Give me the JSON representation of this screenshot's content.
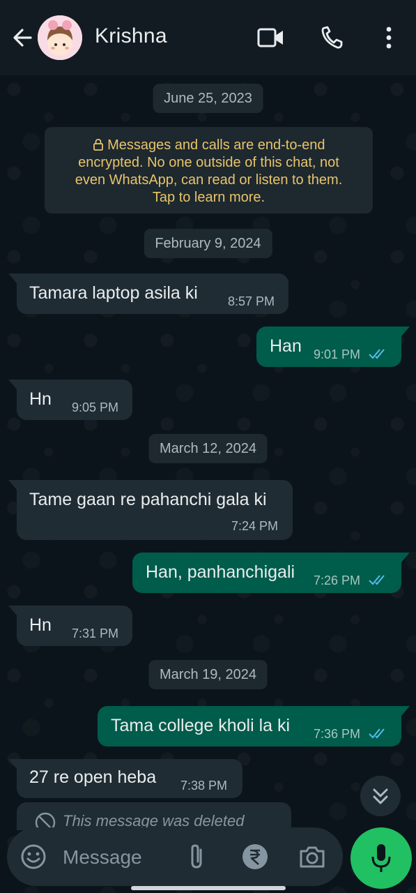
{
  "header": {
    "contact_name": "Krishna",
    "icons": [
      "back-arrow-icon",
      "video-call-icon",
      "voice-call-icon",
      "more-options-icon"
    ]
  },
  "chat": {
    "date_chips": [
      "June 25, 2023",
      "February 9, 2024",
      "March 12, 2024",
      "March 19, 2024"
    ],
    "encryption_notice": [
      "Messages and calls are end-to-end",
      "encrypted. No one outside of this chat, not",
      "even WhatsApp, can read or listen to them.",
      "Tap to learn more."
    ],
    "messages": [
      {
        "dir": "in",
        "text": "Tamara laptop asila ki",
        "time": "8:57 PM"
      },
      {
        "dir": "out",
        "text": "Han",
        "time": "9:01 PM",
        "status": "read"
      },
      {
        "dir": "in",
        "text": "Hn",
        "time": "9:05 PM"
      },
      {
        "dir": "in",
        "text": "Tame gaan re pahanchi gala ki",
        "time": "7:24 PM"
      },
      {
        "dir": "out",
        "text": "Han, panhanchigali",
        "time": "7:26 PM",
        "status": "read"
      },
      {
        "dir": "in",
        "text": "Hn",
        "time": "7:31 PM"
      },
      {
        "dir": "out",
        "text": "Tama college kholi la ki",
        "time": "7:36 PM",
        "status": "read"
      },
      {
        "dir": "in",
        "text": "27 re open heba",
        "time": "7:38 PM"
      }
    ],
    "deleted_message": "This message was deleted"
  },
  "input": {
    "placeholder": "Message",
    "icons": [
      "emoji-icon",
      "attach-icon",
      "rupee-payment-icon",
      "camera-icon",
      "mic-icon"
    ]
  },
  "colors": {
    "background": "#0b141a",
    "header": "#121b22",
    "incoming_bubble": "#202c33",
    "outgoing_bubble": "#005c4b",
    "encryption_text": "#e9c46a",
    "read_ticks": "#53bdeb",
    "mic_button": "#21c063"
  }
}
